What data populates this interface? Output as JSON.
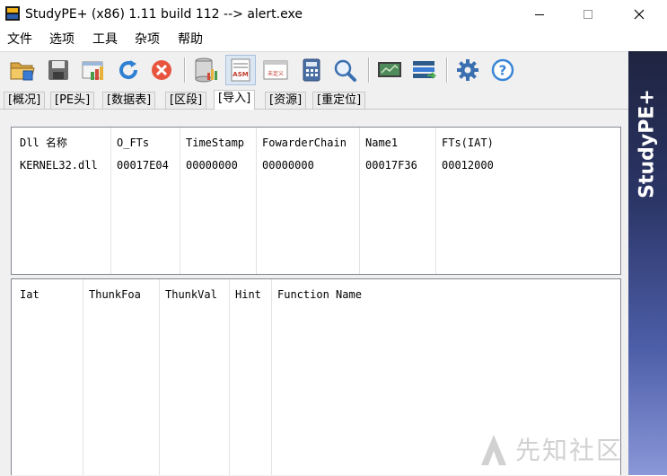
{
  "window": {
    "title": "StudyPE+ (x86) 1.11 build 112  --> alert.exe"
  },
  "menu": {
    "items": [
      "文件",
      "选项",
      "工具",
      "杂项",
      "帮助"
    ]
  },
  "toolbar": {
    "buttons": [
      {
        "icon": "open-folder-icon"
      },
      {
        "icon": "save-icon"
      },
      {
        "icon": "view-icon"
      },
      {
        "icon": "refresh-icon"
      },
      {
        "icon": "stop-icon"
      },
      {
        "icon": "database-icon"
      },
      {
        "icon": "asm-icon",
        "text": "ASM"
      },
      {
        "icon": "hex-icon",
        "text": "未定义"
      },
      {
        "icon": "calculator-icon"
      },
      {
        "icon": "search-icon"
      },
      {
        "icon": "monitor-icon"
      },
      {
        "icon": "network-icon"
      },
      {
        "icon": "settings-icon"
      },
      {
        "icon": "help-icon",
        "text": "?"
      }
    ]
  },
  "tabs": [
    "[概况]",
    "[PE头]",
    "[数据表]",
    "[区段]",
    "[导入]",
    "[资源]",
    "[重定位]"
  ],
  "active_tab": "[导入]",
  "dll_table": {
    "headers": [
      "Dll 名称",
      "O_FTs",
      "TimeStamp",
      "FowarderChain",
      "Name1",
      "FTs(IAT)"
    ],
    "rows": [
      [
        "KERNEL32.dll",
        "00017E04",
        "00000000",
        "00000000",
        "00017F36",
        "00012000"
      ]
    ]
  },
  "func_table": {
    "headers": [
      "Iat",
      "ThunkFoa",
      "ThunkVal",
      "Hint",
      "Function Name"
    ],
    "rows": []
  },
  "banner": {
    "text": "StudyPE+"
  },
  "watermark": {
    "text": "先知社区"
  },
  "colors": {
    "banner_dark": "#1f2440",
    "banner_light": "#8a97d8",
    "stop_red": "#e8553f",
    "refresh_blue": "#2f7fd3",
    "help_blue": "#3a86d6"
  }
}
